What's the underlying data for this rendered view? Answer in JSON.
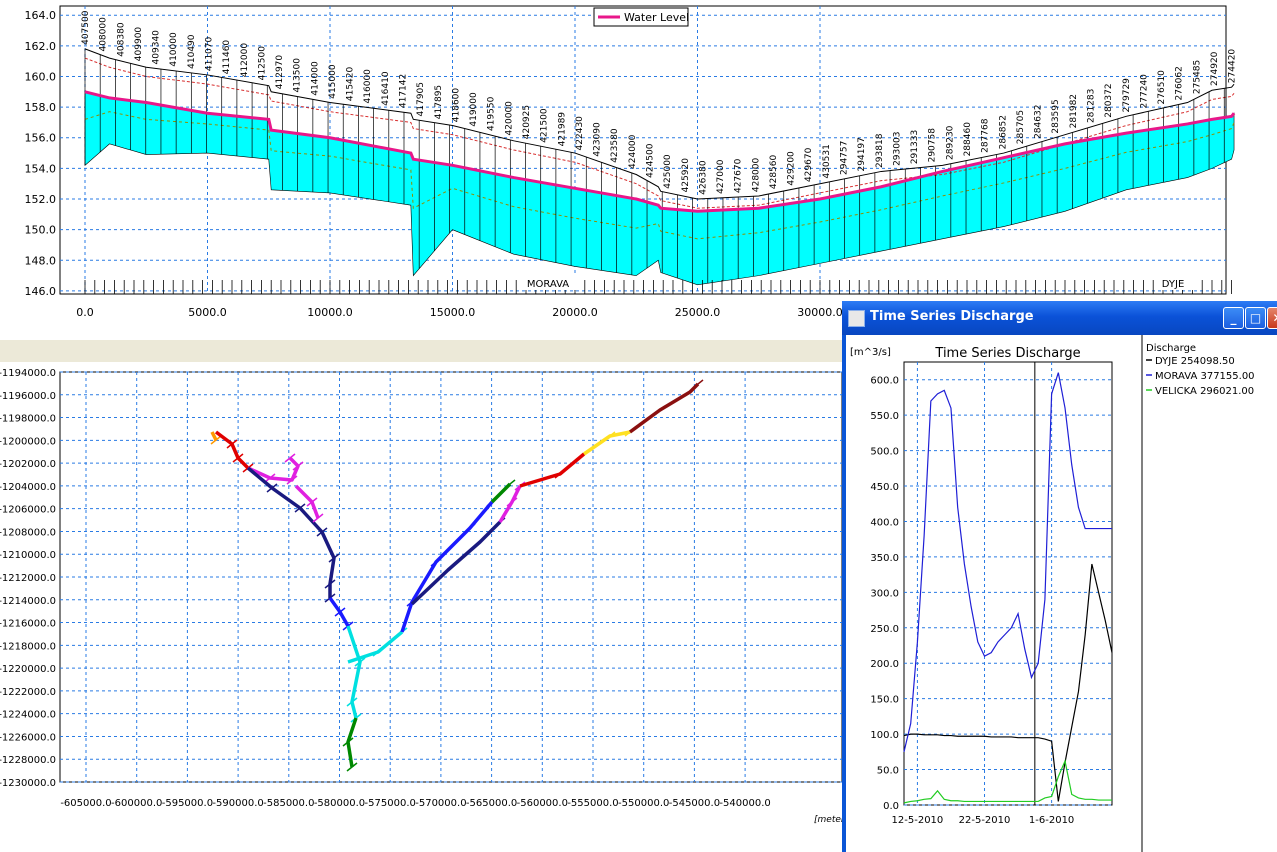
{
  "profile_plot": {
    "legend_label": "Water Level",
    "y_ticks": [
      "164.0",
      "162.0",
      "160.0",
      "158.0",
      "156.0",
      "154.0",
      "152.0",
      "150.0",
      "148.0",
      "146.0"
    ],
    "x_ticks": [
      "0.0",
      "5000.0",
      "10000.0",
      "15000.0",
      "20000.0",
      "25000.0",
      "30000.0"
    ],
    "branch_labels": [
      "MORAVA",
      "DYJE"
    ],
    "chainage_labels": [
      "407500",
      "408000",
      "408380",
      "409900",
      "409340",
      "410000",
      "410490",
      "411070",
      "411460",
      "412000",
      "412500",
      "412970",
      "413500",
      "414000",
      "415000",
      "415420",
      "416000",
      "416410",
      "417142",
      "417905",
      "417895",
      "418600",
      "419000",
      "419550",
      "420000",
      "420925",
      "421500",
      "421989",
      "422430",
      "423090",
      "423580",
      "424000",
      "424500",
      "425000",
      "425920",
      "426380",
      "427000",
      "427670",
      "428000",
      "428560",
      "429200",
      "429670",
      "430531",
      "294757",
      "294197",
      "293818",
      "293003",
      "291333",
      "290758",
      "289230",
      "288460",
      "287768",
      "286852",
      "285705",
      "284632",
      "283595",
      "281982",
      "281283",
      "280372",
      "279729",
      "277240",
      "276510",
      "276062",
      "275485",
      "274920",
      "274420"
    ]
  },
  "map_plot": {
    "y_ticks": [
      "-1194000.0",
      "-1196000.0",
      "-1198000.0",
      "-1200000.0",
      "-1202000.0",
      "-1204000.0",
      "-1206000.0",
      "-1208000.0",
      "-1210000.0",
      "-1212000.0",
      "-1214000.0",
      "-1216000.0",
      "-1218000.0",
      "-1220000.0",
      "-1222000.0",
      "-1224000.0",
      "-1226000.0",
      "-1228000.0",
      "-1230000.0"
    ],
    "x_ticks": [
      "-605000.0",
      "-600000.0",
      "-595000.0",
      "-590000.0",
      "-585000.0",
      "-580000.0",
      "-575000.0",
      "-570000.0",
      "-565000.0",
      "-560000.0",
      "-555000.0",
      "-550000.0",
      "-545000.0",
      "-540000.0"
    ],
    "unit_label": "[meter"
  },
  "ts_window": {
    "title": "Time Series Discharge",
    "buttons": {
      "minimize": "_",
      "maximize": "□",
      "close": "✕"
    }
  },
  "chart_data": {
    "type": "line",
    "title": "Time Series Discharge",
    "ylabel": "[m^3/s]",
    "ylim": [
      0,
      625
    ],
    "y_ticks": [
      "600.0",
      "550.0",
      "500.0",
      "450.0",
      "400.0",
      "350.0",
      "300.0",
      "250.0",
      "200.0",
      "150.0",
      "100.0",
      "50.0",
      "0.0"
    ],
    "x_ticks": [
      "12-5-2010",
      "22-5-2010",
      "1-6-2010"
    ],
    "x": [
      "2010-05-10",
      "2010-05-11",
      "2010-05-12",
      "2010-05-13",
      "2010-05-14",
      "2010-05-15",
      "2010-05-16",
      "2010-05-17",
      "2010-05-18",
      "2010-05-19",
      "2010-05-20",
      "2010-05-21",
      "2010-05-22",
      "2010-05-23",
      "2010-05-24",
      "2010-05-25",
      "2010-05-26",
      "2010-05-27",
      "2010-05-28",
      "2010-05-29",
      "2010-05-30",
      "2010-05-31",
      "2010-06-01",
      "2010-06-02",
      "2010-06-03",
      "2010-06-04",
      "2010-06-05",
      "2010-06-06",
      "2010-06-07",
      "2010-06-08",
      "2010-06-09",
      "2010-06-10"
    ],
    "legend_title": "Discharge",
    "series": [
      {
        "name": "DYJE  254098.50",
        "color": "#000000",
        "values": [
          98,
          100,
          100,
          99,
          99,
          99,
          98,
          98,
          97,
          97,
          97,
          97,
          97,
          96,
          96,
          96,
          96,
          95,
          95,
          95,
          95,
          93,
          90,
          5,
          60,
          110,
          160,
          240,
          340,
          300,
          260,
          215
        ]
      },
      {
        "name": "MORAVA  377155.00",
        "color": "#1f1fd6",
        "values": [
          75,
          115,
          230,
          380,
          570,
          580,
          585,
          560,
          420,
          340,
          280,
          230,
          210,
          215,
          230,
          240,
          250,
          270,
          220,
          180,
          200,
          290,
          580,
          610,
          560,
          480,
          420,
          390,
          390,
          390,
          390,
          390
        ]
      },
      {
        "name": "VELICKA  296021.00",
        "color": "#22cc22",
        "values": [
          3,
          5,
          6,
          8,
          9,
          20,
          8,
          6,
          6,
          5,
          5,
          5,
          5,
          5,
          5,
          5,
          5,
          5,
          5,
          5,
          5,
          10,
          12,
          40,
          62,
          15,
          10,
          8,
          8,
          7,
          7,
          7
        ]
      }
    ]
  }
}
